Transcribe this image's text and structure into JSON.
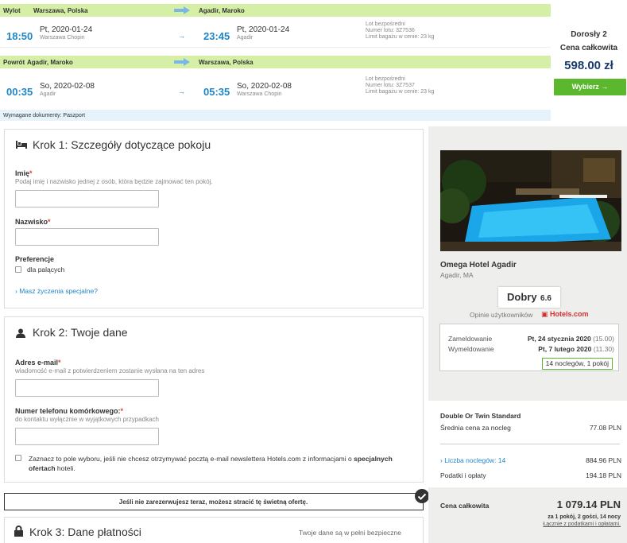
{
  "flight": {
    "outbound": {
      "label": "Wylot",
      "from": "Warszawa, Polska",
      "to": "Agadir, Maroko",
      "dep_time": "18:50",
      "dep_date": "Pt, 2020-01-24",
      "dep_airport": "Warszawa Chopin",
      "arr_time": "23:45",
      "arr_date": "Pt, 2020-01-24",
      "arr_airport": "Agadir",
      "info1": "Lot bezpośredni",
      "info2": "Numer lotu: 3Z7536",
      "info3": "Limit bagażu w cenie: 23 kg"
    },
    "return": {
      "label": "Powrót",
      "from": "Agadir, Maroko",
      "to": "Warszawa, Polska",
      "dep_time": "00:35",
      "dep_date": "So, 2020-02-08",
      "dep_airport": "Agadir",
      "arr_time": "05:35",
      "arr_date": "So, 2020-02-08",
      "arr_airport": "Warszawa Chopin",
      "info1": "Lot bezpośredni",
      "info2": "Numer lotu: 3Z7537",
      "info3": "Limit bagażu w cenie: 23 kg"
    },
    "docs": "Wymagane dokumenty: Paszport",
    "price": {
      "pax": "Dorosły 2",
      "total_label": "Cena całkowita",
      "amount": "598.00 zł",
      "select": "Wybierz"
    }
  },
  "step1": {
    "title": "Krok 1: Szczegóły dotyczące pokoju",
    "first_label": "Imię",
    "first_hint": "Podaj imię i nazwisko jednej z osób, która będzie zajmować ten pokój.",
    "last_label": "Nazwisko",
    "pref_label": "Preferencje",
    "smoking": "dla palących",
    "special": "Masz życzenia specjalne?"
  },
  "step2": {
    "title": "Krok 2: Twoje dane",
    "email_label": "Adres e-mail",
    "email_hint": "wiadomość e-mail z potwierdzeniem zostanie wysłana na ten adres",
    "phone_label": "Numer telefonu komórkowego:",
    "phone_hint": "do kontaktu wyłącznie w wyjątkowych przypadkach",
    "newsletter_a": "Zaznacz to pole wyboru, jeśli nie chcesz otrzymywać pocztą e-mail newslettera Hotels.com z informacjami o",
    "newsletter_b": "specjalnych ofertach",
    "newsletter_c": " hoteli."
  },
  "warning": "Jeśli nie zarezerwujesz teraz, możesz stracić tę świetną ofertę.",
  "step3": {
    "title": "Krok 3: Dane płatności",
    "secure": "Twoje dane są w pełni bezpieczne"
  },
  "hotel": {
    "name": "Omega Hotel Agadir",
    "location": "Agadir, MA",
    "rating_word": "Dobry",
    "rating_value": "6.6",
    "reviews_label": "Opinie użytkowników",
    "brand": "Hotels.com",
    "checkin_label": "Zameldowanie",
    "checkin_value": "Pt, 24 stycznia 2020",
    "checkin_time": "(15.00)",
    "checkout_label": "Wymeldowanie",
    "checkout_value": "Pt, 7 lutego 2020",
    "checkout_time": "(11.30)",
    "nights_badge": "14 noclegów, 1 pokój",
    "room": "Double Or Twin Standard",
    "avg_label": "Średnia cena za nocleg",
    "avg_value": "77.08 PLN",
    "nights_label": "Liczba noclegów: 14",
    "nights_value": "884.96 PLN",
    "tax_label": "Podatki i opłaty",
    "tax_value": "194.18 PLN",
    "total_label": "Cena całkowita",
    "total_value": "1 079.14 PLN",
    "total_sub": "za 1 pokój, 2 gości, 14 nocy",
    "total_sub2": "Łącznie z podatkami i opłatami."
  },
  "colors": {
    "accent_blue": "#1f86c6",
    "green": "#5bb82e",
    "bar_green": "#d5f0a6",
    "brand_red": "#d32f2f"
  }
}
